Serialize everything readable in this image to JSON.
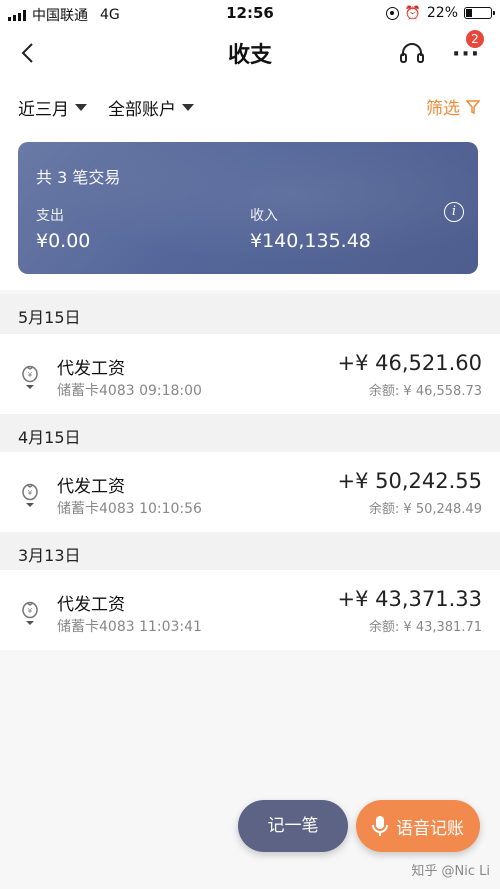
{
  "status_bar": {
    "carrier": "中国联通",
    "network": "4G",
    "time": "12:56",
    "battery": "22%",
    "battery_level": 0.22
  },
  "header": {
    "title": "收支",
    "notification_count": "2",
    "more_label": "···"
  },
  "filters": {
    "period": "近三月",
    "account": "全部账户",
    "screen_label": "筛选"
  },
  "summary": {
    "count_text": "共 3 笔交易",
    "expense_label": "支出",
    "expense_value": "¥0.00",
    "income_label": "收入",
    "income_value": "¥140,135.48",
    "info_icon_text": "i"
  },
  "groups": [
    {
      "date": "5月15日",
      "name": "代发工资",
      "sub": "储蓄卡4083 09:18:00",
      "amount": "+¥ 46,521.60",
      "balance": "余额: ¥ 46,558.73"
    },
    {
      "date": "4月15日",
      "name": "代发工资",
      "sub": "储蓄卡4083 10:10:56",
      "amount": "+¥ 50,242.55",
      "balance": "余额: ¥ 50,248.49"
    },
    {
      "date": "3月13日",
      "name": "代发工资",
      "sub": "储蓄卡4083 11:03:41",
      "amount": "+¥ 43,371.33",
      "balance": "余额: ¥ 43,381.71"
    }
  ],
  "buttons": {
    "record": "记一笔",
    "voice": "语音记账"
  },
  "watermark": "知乎 @Nic Li",
  "colors": {
    "accent_orange": "#f08b3a",
    "card_blue": "#55679a",
    "badge_red": "#e8473b"
  }
}
